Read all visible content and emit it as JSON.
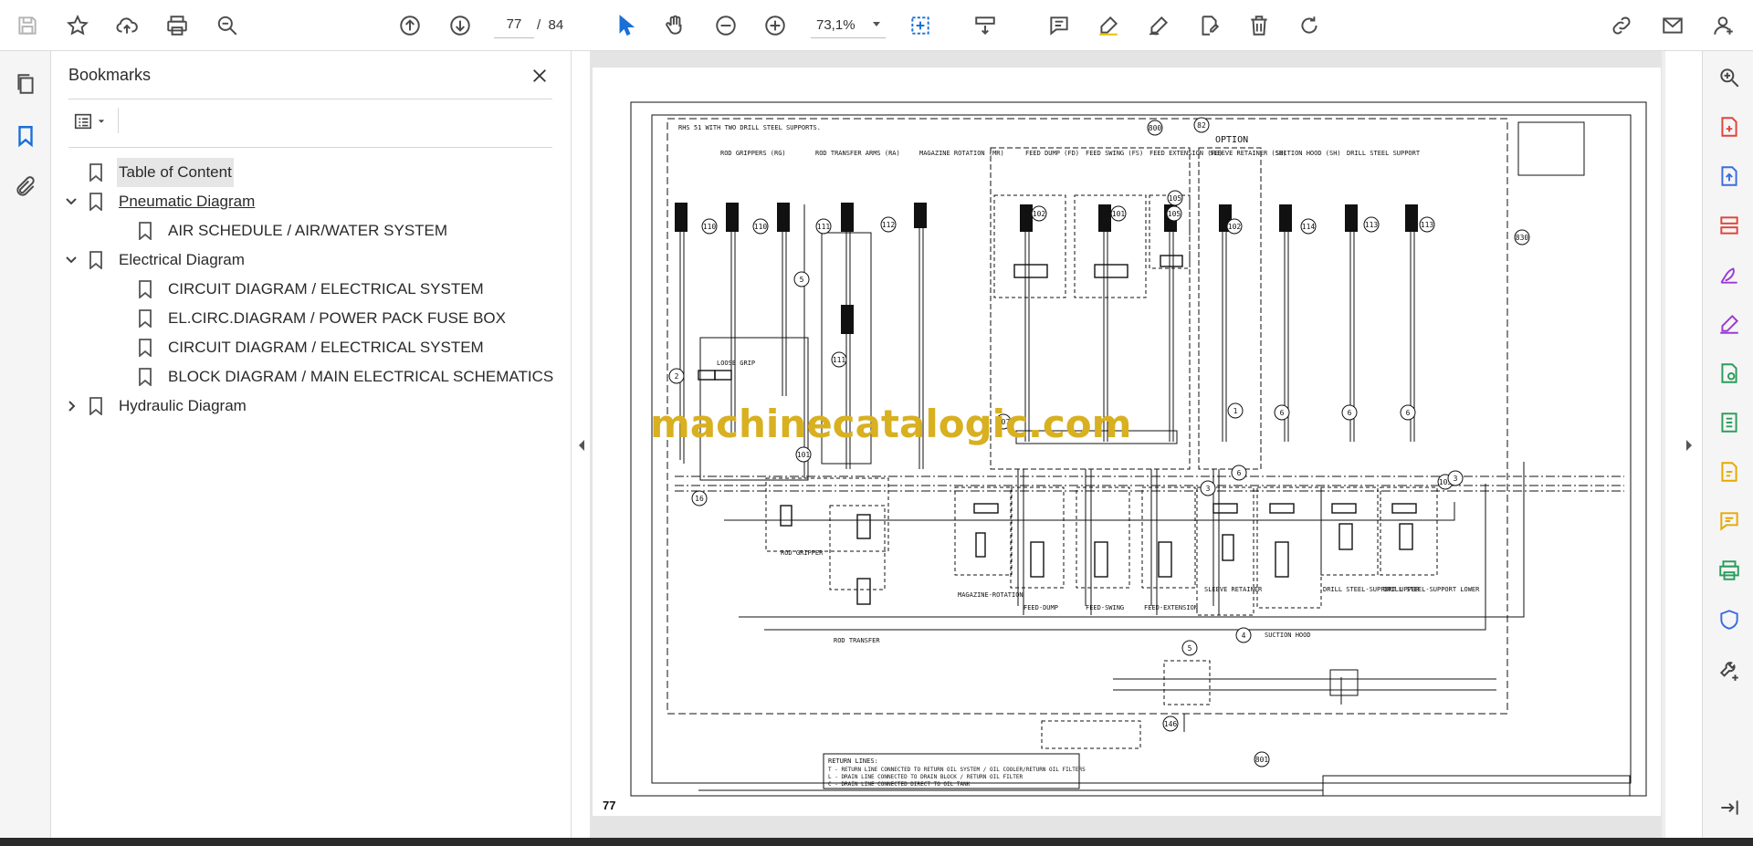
{
  "toolbar": {
    "page_current": "77",
    "page_separator": "/",
    "page_total": "84",
    "zoom_value": "73,1%",
    "icons": [
      "save-icon",
      "star-icon",
      "cloud-upload-icon",
      "print-icon",
      "zoom-search-icon",
      "page-up-icon",
      "page-down-icon",
      "select-arrow-icon",
      "hand-icon",
      "zoom-out-icon",
      "zoom-in-icon",
      "marquee-zoom-icon",
      "scroll-mode-icon",
      "comment-icon",
      "highlight-icon",
      "draw-icon",
      "stamp-icon",
      "delete-icon",
      "rotate-icon",
      "share-link-icon",
      "email-icon",
      "account-icon"
    ]
  },
  "left_rail": {
    "icons": [
      "pages-icon",
      "bookmark-icon",
      "attachment-icon"
    ]
  },
  "bookmarks": {
    "title": "Bookmarks",
    "items": [
      {
        "label": "Table of Content",
        "level": 0,
        "expander": "none",
        "selected": true,
        "link": false
      },
      {
        "label": "Pneumatic Diagram",
        "level": 0,
        "expander": "expanded",
        "selected": false,
        "link": true
      },
      {
        "label": "AIR SCHEDULE / AIR/WATER SYSTEM",
        "level": 1,
        "expander": "none",
        "selected": false,
        "link": false
      },
      {
        "label": "Electrical Diagram",
        "level": 0,
        "expander": "expanded",
        "selected": false,
        "link": false
      },
      {
        "label": "CIRCUIT DIAGRAM / ELECTRICAL SYSTEM",
        "level": 1,
        "expander": "none",
        "selected": false,
        "link": false
      },
      {
        "label": "EL.CIRC.DIAGRAM / POWER PACK FUSE BOX",
        "level": 1,
        "expander": "none",
        "selected": false,
        "link": false
      },
      {
        "label": "CIRCUIT DIAGRAM / ELECTRICAL SYSTEM",
        "level": 1,
        "expander": "none",
        "selected": false,
        "link": false
      },
      {
        "label": "BLOCK DIAGRAM / MAIN ELECTRICAL SCHEMATICS",
        "level": 1,
        "expander": "none",
        "selected": false,
        "link": false
      },
      {
        "label": "Hydraulic Diagram",
        "level": 0,
        "expander": "collapsed",
        "selected": false,
        "link": false
      }
    ]
  },
  "document": {
    "page_label": "77",
    "watermark": "machinecatalogic.com",
    "schematic_texts": {
      "header_note": "RHS 51 WITH TWO DRILL STEEL SUPPORTS.",
      "option": "OPTION",
      "rod_grippers": "ROD GRIPPERS (RG)",
      "rod_transfer_arms": "ROD TRANSFER ARMS (RA)",
      "magazine_rotation": "MAGAZINE ROTATION (MR)",
      "feed_dump": "FEED DUMP (FD)",
      "feed_swing": "FEED SWING (FS)",
      "feed_extension": "FEED EXTENSION (FE)",
      "sleeve_retainer": "SLEEVE RETAINER (SR)",
      "suction_hood": "SUCTION HOOD (SH)",
      "drill_steel_support": "DRILL STEEL SUPPORT",
      "loose_grip": "LOOSE GRIP",
      "rod_gripper": "ROD GRIPPER",
      "rod_transfer": "ROD TRANSFER",
      "magazine_rotation_label": "MAGAZINE-ROTATION",
      "feed_dump_label": "FEED-DUMP",
      "feed_swing_label": "FEED-SWING",
      "feed_extension_label": "FEED-EXTENSION",
      "sleeve_retainer_label": "SLEEVE RETAINER",
      "suction_hood_label": "SUCTION HOOD",
      "dss_upper": "DRILL STEEL-SUPPORT UPPER",
      "dss_lower": "DRILL STEEL-SUPPORT LOWER",
      "return_title": "RETURN LINES:",
      "return_t": "T - RETURN LINE CONNECTED TO RETURN OIL SYSTEM / OIL COOLER/RETURN OIL FILTERS",
      "return_l": "L - DRAIN LINE CONNECTED TO DRAIN BLOCK / RETURN OIL FILTER",
      "return_c": "C - DRAIN LINE CONNECTED DIRECT TO OIL TANK",
      "callouts": [
        "110",
        "110",
        "111",
        "112",
        "102",
        "101",
        "105",
        "102",
        "114",
        "113",
        "113",
        "830",
        "5",
        "111",
        "107",
        "2",
        "16",
        "101",
        "1",
        "6",
        "6",
        "6",
        "3",
        "103",
        "3",
        "6",
        "4",
        "5",
        "105",
        "146",
        "801",
        "800",
        "82"
      ]
    }
  },
  "right_rail": {
    "icons": [
      "zoom-tool-icon",
      "create-pdf-icon",
      "export-pdf-icon",
      "organize-pages-icon",
      "fill-sign-icon",
      "sign-icon",
      "send-review-icon",
      "compress-icon",
      "edit-pdf-icon",
      "comment-tool-icon",
      "print-production-icon",
      "protect-icon",
      "more-tools-icon",
      "expand-panel-icon"
    ],
    "colors": [
      "#444444",
      "#e0443a",
      "#3a6de0",
      "#e0443a",
      "#9b3ad6",
      "#9b3ad6",
      "#2a9d5c",
      "#2a9d5c",
      "#e8a800",
      "#e8a800",
      "#2a9d5c",
      "#3a6de0",
      "#444444",
      "#444444"
    ]
  }
}
